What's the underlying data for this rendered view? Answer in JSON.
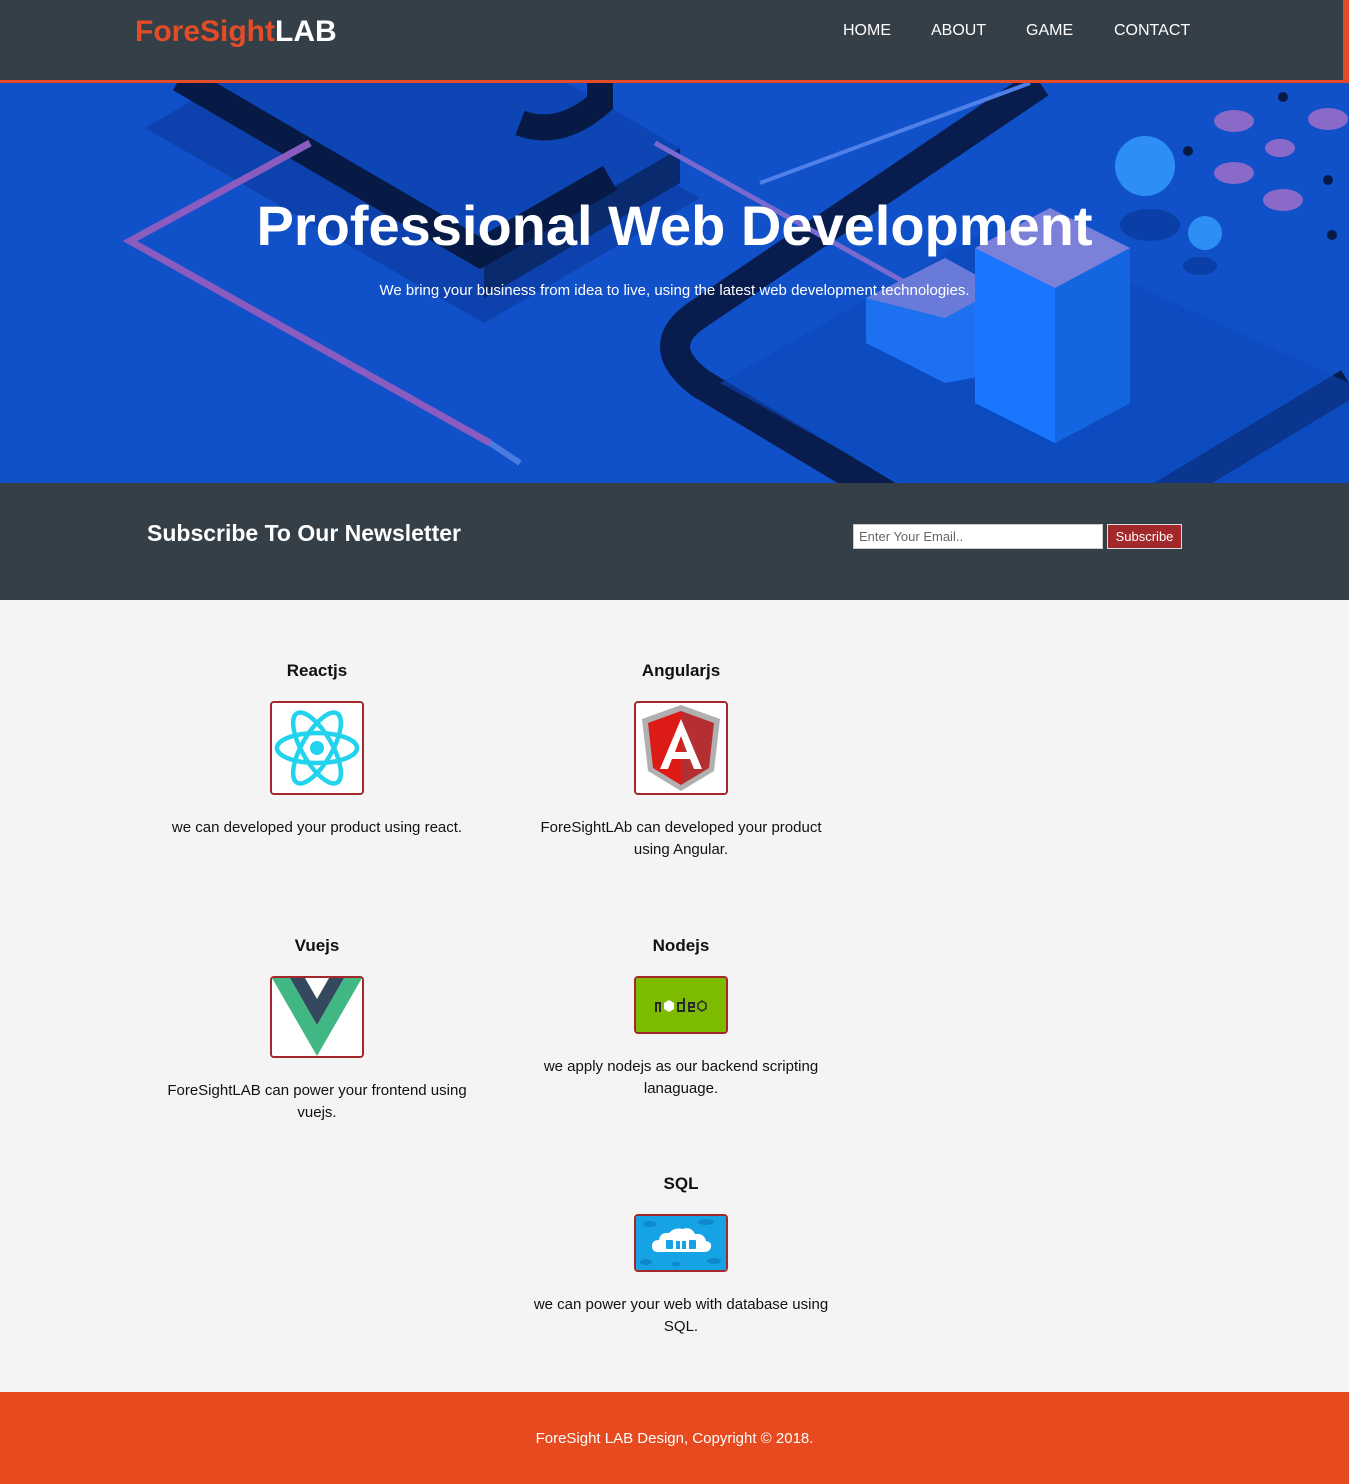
{
  "header": {
    "logo_highlight": "ForeSight",
    "logo_rest": "LAB",
    "nav": [
      "HOME",
      "ABOUT",
      "GAME",
      "CONTACT"
    ]
  },
  "hero": {
    "title": "Professional Web Development",
    "subtitle": "We bring your business from idea to live, using the latest web development technologies."
  },
  "newsletter": {
    "title": "Subscribe To Our Newsletter",
    "email_placeholder": "Enter Your Email..",
    "button_label": "Subscribe"
  },
  "technologies": [
    {
      "title": "Reactjs",
      "icon": "react-icon",
      "description": "we can developed your product using react."
    },
    {
      "title": "Angularjs",
      "icon": "angular-icon",
      "description": "ForeSightLAb can developed your product using Angular."
    },
    {
      "title": "Vuejs",
      "icon": "vue-icon",
      "description": "ForeSightLAB can power your frontend using vuejs."
    },
    {
      "title": "Nodejs",
      "icon": "nodejs-icon",
      "description": "we apply nodejs as our backend scripting lanaguage."
    },
    {
      "title": "SQL",
      "icon": "sql-icon",
      "description": "we can power your web with database using SQL."
    }
  ],
  "footer": {
    "text": "ForeSight LAB Design, Copyright © 2018."
  },
  "colors": {
    "accent": "#e34c26",
    "header_bg": "#353f47",
    "hero_bg": "#1050c8",
    "button_red": "#a3282b",
    "footer_bg": "#e64a1e"
  }
}
